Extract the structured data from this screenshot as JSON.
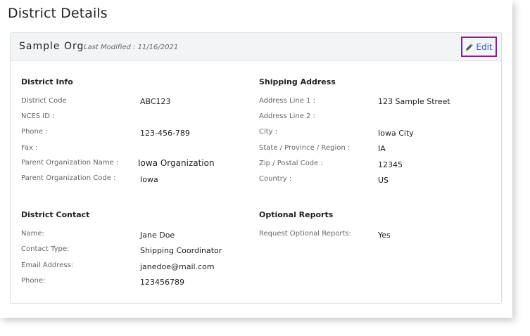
{
  "page": {
    "title": "District Details"
  },
  "header": {
    "org_name": "Sample Org",
    "last_modified": "Last Modified : 11/16/2021",
    "edit_label": "Edit",
    "edit_icon": "pencil-icon",
    "edit_border_color": "#8a1f87",
    "link_color": "#3b5fa8"
  },
  "district_info": {
    "title": "District Info",
    "fields": [
      {
        "label": "District Code",
        "value": "ABC123"
      },
      {
        "label": "NCES ID :",
        "value": ""
      },
      {
        "label": "Phone :",
        "value": "123-456-789"
      },
      {
        "label": "Fax :",
        "value": ""
      },
      {
        "label": "Parent Organization Name :",
        "value": "Iowa Organization"
      },
      {
        "label": "Parent Organization Code :",
        "value": "Iowa"
      }
    ]
  },
  "shipping_address": {
    "title": "Shipping Address",
    "fields": [
      {
        "label": "Address Line 1 :",
        "value": "123 Sample Street"
      },
      {
        "label": "Address Line 2 :",
        "value": ""
      },
      {
        "label": "City :",
        "value": "Iowa City"
      },
      {
        "label": "State / Province / Region :",
        "value": "IA"
      },
      {
        "label": "Zip / Postal Code :",
        "value": "12345"
      },
      {
        "label": "Country :",
        "value": "US"
      }
    ]
  },
  "district_contact": {
    "title": "District Contact",
    "fields": [
      {
        "label": "Name:",
        "value": "Jane Doe"
      },
      {
        "label": "Contact Type:",
        "value": "Shipping Coordinator"
      },
      {
        "label": "Email Address:",
        "value": "janedoe@mail.com"
      },
      {
        "label": "Phone:",
        "value": "123456789"
      }
    ]
  },
  "optional_reports": {
    "title": "Optional Reports",
    "fields": [
      {
        "label": "Request Optional Reports:",
        "value": "Yes"
      }
    ]
  }
}
